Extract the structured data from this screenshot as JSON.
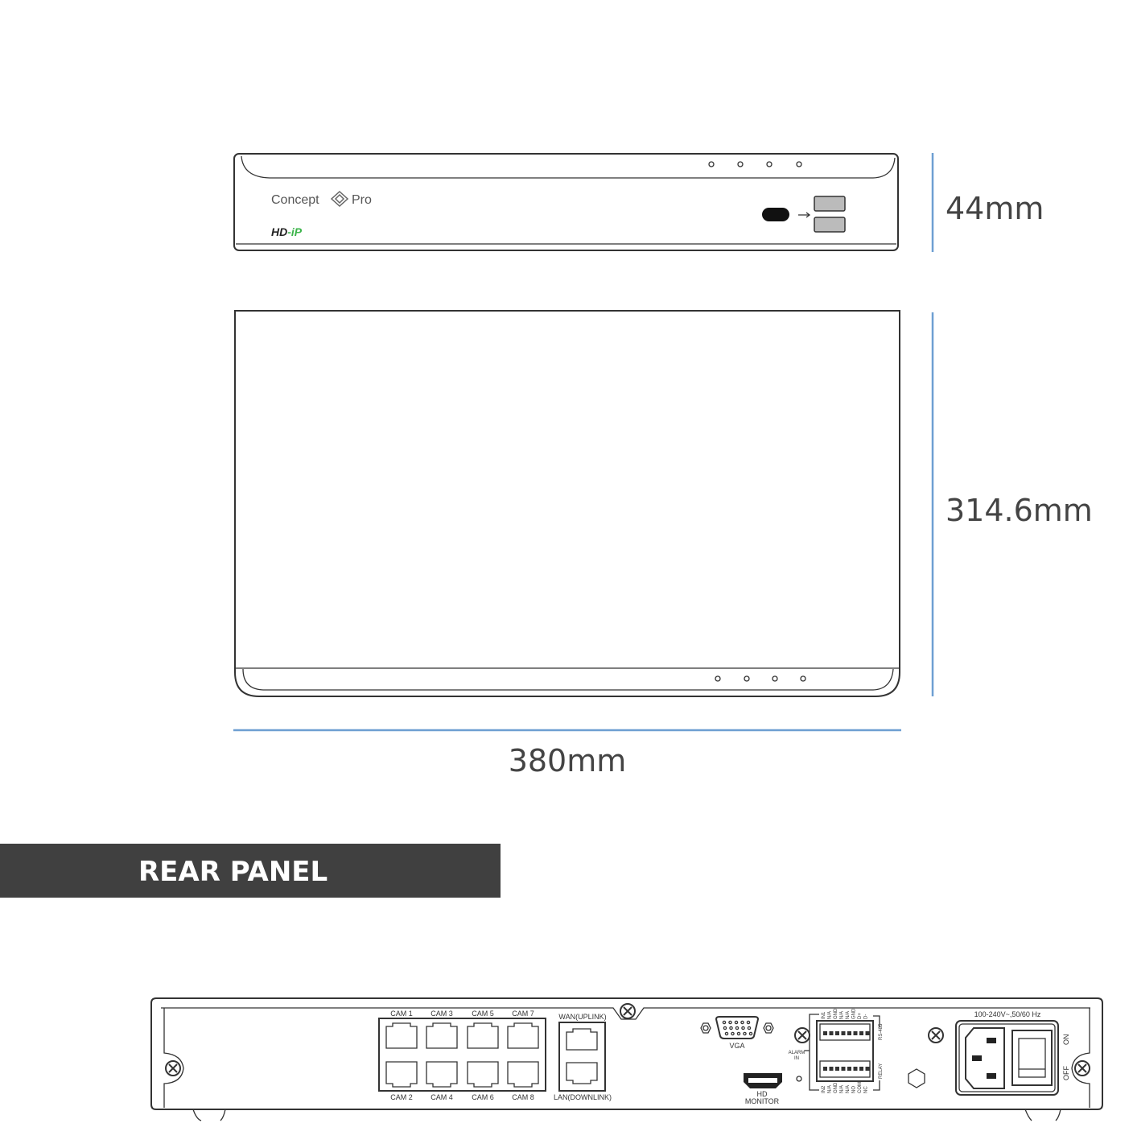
{
  "front_panel": {
    "brand_left": "Concept",
    "brand_right": "Pro",
    "series_prefix": "HD",
    "series_suffix": "-iP",
    "series_color": "#3cb44a"
  },
  "dimensions": {
    "height": "44mm",
    "depth": "314.6mm",
    "width": "380mm",
    "line_color": "#6e9fd2"
  },
  "section": {
    "title": "REAR PANEL",
    "background": "#404040"
  },
  "rear_panel": {
    "cam_top": [
      "CAM 1",
      "CAM 3",
      "CAM 5",
      "CAM 7"
    ],
    "cam_bottom": [
      "CAM 2",
      "CAM 4",
      "CAM 6",
      "CAM 8"
    ],
    "wan": "WAN(UPLINK)",
    "lan": "LAN(DOWNLINK)",
    "vga": "VGA",
    "hd": "HD",
    "monitor": "MONITOR",
    "alarm": "ALARM",
    "alarm_in": "IN",
    "rs485": "RS-485",
    "relay": "RELAY",
    "terminal_top": [
      "IN1",
      "N/A",
      "GND",
      "N/A",
      "N/A",
      "GND",
      "D+",
      "D-"
    ],
    "terminal_bottom": [
      "IN2",
      "N/A",
      "GND",
      "N/A",
      "N/A",
      "NO",
      "COM",
      "NC"
    ],
    "power_rating": "100-240V~,50/60 Hz",
    "on": "ON",
    "off": "OFF"
  }
}
